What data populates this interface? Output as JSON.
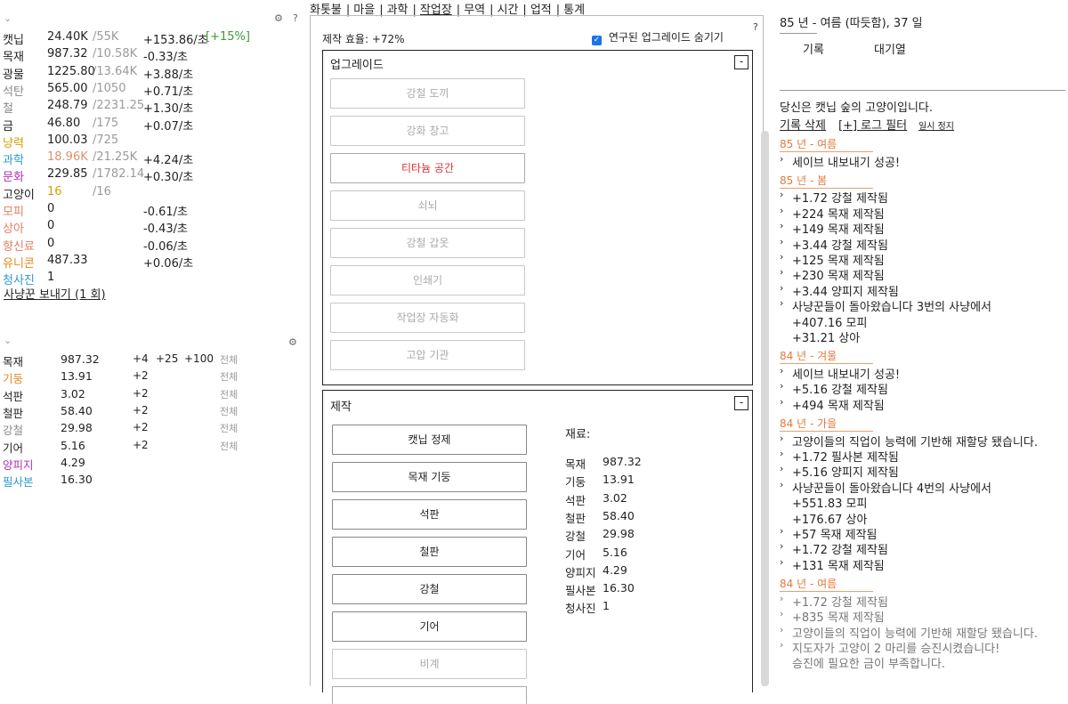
{
  "nav": [
    "화톳불",
    "마을",
    "과학",
    "작업장",
    "무역",
    "시간",
    "업적",
    "통계"
  ],
  "resources": [
    {
      "name": "캣닙",
      "color": "#222",
      "amount": "24.40K",
      "max": "/55K",
      "rate": "+153.86/초",
      "bonus": "[+15%]"
    },
    {
      "name": "목재",
      "color": "#222",
      "amount": "987.32",
      "max": "/10.58K",
      "rate": "-0.33/초",
      "bonus": ""
    },
    {
      "name": "광물",
      "color": "#222",
      "amount": "1225.80",
      "max": "/13.64K",
      "rate": "+3.88/초",
      "bonus": ""
    },
    {
      "name": "석탄",
      "color": "#888",
      "amount": "565.00",
      "max": "/1050",
      "rate": "+0.71/초",
      "bonus": ""
    },
    {
      "name": "철",
      "color": "#888",
      "amount": "248.79",
      "max": "/2231.25",
      "rate": "+1.30/초",
      "bonus": ""
    },
    {
      "name": "금",
      "color": "#222",
      "amount": "46.80",
      "max": "/175",
      "rate": "+0.07/초",
      "bonus": ""
    },
    {
      "name": "냥력",
      "color": "#d6a000",
      "amount": "100.03",
      "max": "/725",
      "rate": "",
      "bonus": ""
    },
    {
      "name": "과학",
      "color": "#2a9ad0",
      "amount": "18.96K",
      "amountColor": "#e0906a",
      "max": "/21.25K",
      "rate": "+4.24/초",
      "bonus": ""
    },
    {
      "name": "문화",
      "color": "#b030b0",
      "amount": "229.85",
      "max": "/1782.14",
      "rate": "+0.30/초",
      "bonus": ""
    },
    {
      "name": "고양이",
      "color": "#222",
      "amount": "16",
      "amountColor": "#d6a000",
      "max": "/16",
      "rate": "",
      "bonus": ""
    },
    {
      "name": "모피",
      "color": "#e08060",
      "amount": "0",
      "max": "",
      "rate": "-0.61/초",
      "bonus": ""
    },
    {
      "name": "상아",
      "color": "#e08060",
      "amount": "0",
      "max": "",
      "rate": "-0.43/초",
      "bonus": ""
    },
    {
      "name": "향신료",
      "color": "#e08060",
      "amount": "0",
      "max": "",
      "rate": "-0.06/초",
      "bonus": ""
    },
    {
      "name": "유니콘",
      "color": "#e08a20",
      "amount": "487.33",
      "max": "",
      "rate": "+0.06/초",
      "bonus": ""
    },
    {
      "name": "청사진",
      "color": "#2a9ad0",
      "amount": "1",
      "max": "",
      "rate": "",
      "bonus": ""
    }
  ],
  "hunt_link": "사냥꾼 보내기 (1 회)",
  "craft_resources": [
    {
      "name": "목재",
      "color": "#222",
      "amount": "987.32",
      "a": "+4",
      "b": "+25",
      "c": "+100",
      "all": "전체"
    },
    {
      "name": "기둥",
      "color": "#e08a20",
      "amount": "13.91",
      "a": "+2",
      "b": "",
      "c": "",
      "all": "전체"
    },
    {
      "name": "석판",
      "color": "#222",
      "amount": "3.02",
      "a": "+2",
      "b": "",
      "c": "",
      "all": "전체"
    },
    {
      "name": "철판",
      "color": "#222",
      "amount": "58.40",
      "a": "+2",
      "b": "",
      "c": "",
      "all": "전체"
    },
    {
      "name": "강철",
      "color": "#888",
      "amount": "29.98",
      "a": "+2",
      "b": "",
      "c": "",
      "all": "전체"
    },
    {
      "name": "기어",
      "color": "#222",
      "amount": "5.16",
      "a": "+2",
      "b": "",
      "c": "",
      "all": "전체"
    },
    {
      "name": "양피지",
      "color": "#b030b0",
      "amount": "4.29",
      "a": "",
      "b": "",
      "c": "",
      "all": ""
    },
    {
      "name": "필사본",
      "color": "#2a9ad0",
      "amount": "16.30",
      "a": "",
      "b": "",
      "c": "",
      "all": ""
    }
  ],
  "workshop": {
    "efficiency": "제작 효율: +72%",
    "hide_label": "연구된 업그레이드 숨기기",
    "help": "?",
    "upgrades_title": "업그레이드",
    "collapse": "-",
    "upgrades": [
      {
        "label": "강철 도끼",
        "state": "dis"
      },
      {
        "label": "강화 창고",
        "state": "dis"
      },
      {
        "label": "티타늄 공간",
        "state": "red"
      },
      {
        "label": "쇠뇌",
        "state": "dis"
      },
      {
        "label": "강철 갑옷",
        "state": "dis"
      },
      {
        "label": "인쇄기",
        "state": "dis"
      },
      {
        "label": "작업장 자동화",
        "state": "dis"
      },
      {
        "label": "고압 기관",
        "state": "dis"
      }
    ],
    "craft_title": "제작",
    "crafts": [
      {
        "label": "캣닙 정제",
        "state": "craft"
      },
      {
        "label": "목재 기둥",
        "state": "craft"
      },
      {
        "label": "석판",
        "state": "craft"
      },
      {
        "label": "철판",
        "state": "craft"
      },
      {
        "label": "강철",
        "state": "craft"
      },
      {
        "label": "기어",
        "state": "craft"
      },
      {
        "label": "비계",
        "state": "dis"
      }
    ],
    "materials_title": "재료:",
    "materials": [
      [
        "목재",
        "987.32"
      ],
      [
        "기둥",
        "13.91"
      ],
      [
        "석판",
        "3.02"
      ],
      [
        "철판",
        "58.40"
      ],
      [
        "강철",
        "29.98"
      ],
      [
        "기어",
        "5.16"
      ],
      [
        "양피지",
        "4.29"
      ],
      [
        "필사본",
        "16.30"
      ],
      [
        "청사진",
        "1"
      ]
    ]
  },
  "right": {
    "date": "85 년 - 여름 (따듯함), 37 일",
    "tab_log": "기록",
    "tab_queue": "대기열",
    "intro": "당신은 캣닙 숲의 고양이입니다.",
    "clear_log": "기록 삭제",
    "log_filter": "[+] 로그 필터",
    "pause": "일시 정지",
    "log": [
      {
        "t": "date",
        "text": "85 년 - 여름"
      },
      {
        "t": "item",
        "text": "세이브 내보내기 성공!"
      },
      {
        "t": "date",
        "text": "85 년 - 봄"
      },
      {
        "t": "item",
        "text": "+1.72 강철 제작됨"
      },
      {
        "t": "item",
        "text": "+224 목재 제작됨"
      },
      {
        "t": "item",
        "text": "+149 목재 제작됨"
      },
      {
        "t": "item",
        "text": "+3.44 강철 제작됨"
      },
      {
        "t": "item",
        "text": "+125 목재 제작됨"
      },
      {
        "t": "item",
        "text": "+230 목재 제작됨"
      },
      {
        "t": "item",
        "text": "+3.44 양피지 제작됨"
      },
      {
        "t": "item",
        "text": "사냥꾼들이 돌아왔습니다 3번의 사냥에서"
      },
      {
        "t": "sub",
        "text": "+407.16 모피"
      },
      {
        "t": "sub",
        "text": "+31.21 상아"
      },
      {
        "t": "date",
        "text": "84 년 - 겨울"
      },
      {
        "t": "item",
        "text": "세이브 내보내기 성공!"
      },
      {
        "t": "item",
        "text": "+5.16 강철 제작됨"
      },
      {
        "t": "item",
        "text": "+494 목재 제작됨"
      },
      {
        "t": "date",
        "text": "84 년 - 가을"
      },
      {
        "t": "item",
        "text": "고양이들의 직업이 능력에 기반해 재할당 됐습니다."
      },
      {
        "t": "item",
        "text": "+1.72 필사본 제작됨"
      },
      {
        "t": "item",
        "text": "+5.16 양피지 제작됨"
      },
      {
        "t": "item",
        "text": "사냥꾼들이 돌아왔습니다 4번의 사냥에서"
      },
      {
        "t": "sub",
        "text": "+551.83 모피"
      },
      {
        "t": "sub",
        "text": "+176.67 상아"
      },
      {
        "t": "item",
        "text": "+57 목재 제작됨"
      },
      {
        "t": "item",
        "text": "+1.72 강철 제작됨"
      },
      {
        "t": "item",
        "text": "+131 목재 제작됨"
      },
      {
        "t": "date",
        "text": "84 년 - 여름"
      },
      {
        "t": "item",
        "text": "+1.72 강철 제작됨",
        "fade": true
      },
      {
        "t": "item",
        "text": "+835 목재 제작됨",
        "fade": true
      },
      {
        "t": "item",
        "text": "고양이들의 직업이 능력에 기반해 재할당 됐습니다.",
        "fade": true
      },
      {
        "t": "item",
        "text": "지도자가 고양이 2 마리를 승진시켰습니다!",
        "fade": true
      },
      {
        "t": "sub",
        "text": "승진에 필요한 금이 부족합니다.",
        "fade": true
      }
    ]
  }
}
